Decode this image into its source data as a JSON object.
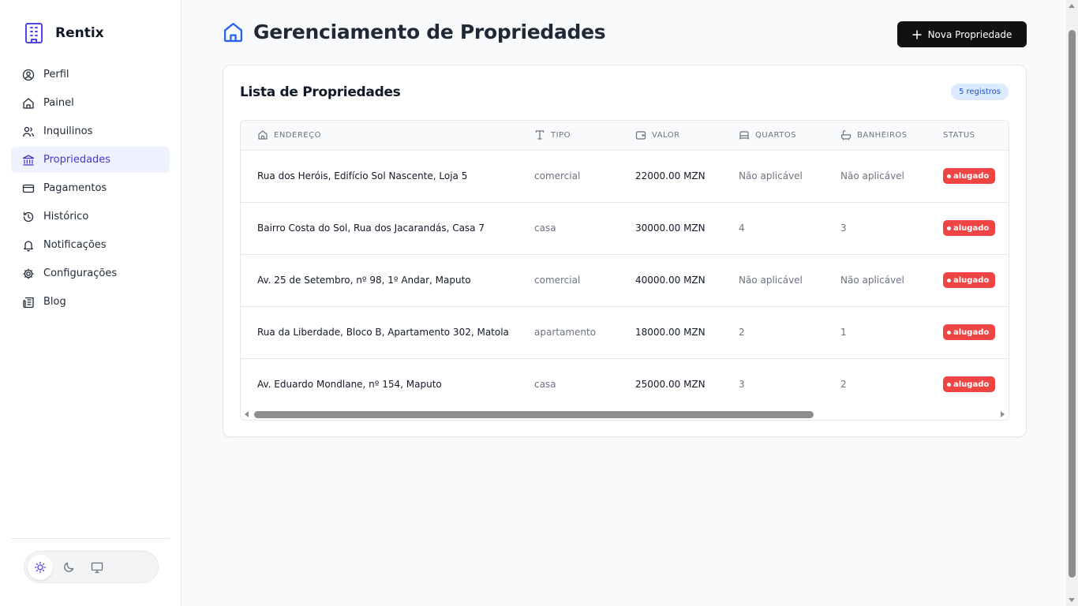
{
  "app": {
    "name": "Rentix",
    "accent": "#4f46e5"
  },
  "sidebar": {
    "items": [
      {
        "label": "Perfil",
        "icon": "user-circle-icon"
      },
      {
        "label": "Painel",
        "icon": "home-icon"
      },
      {
        "label": "Inquilinos",
        "icon": "users-icon"
      },
      {
        "label": "Propriedades",
        "icon": "bank-icon",
        "active": true
      },
      {
        "label": "Pagamentos",
        "icon": "credit-card-icon"
      },
      {
        "label": "Histórico",
        "icon": "history-icon"
      },
      {
        "label": "Notificações",
        "icon": "bell-icon"
      },
      {
        "label": "Configurações",
        "icon": "gear-icon"
      },
      {
        "label": "Blog",
        "icon": "newspaper-icon"
      }
    ],
    "theme_switcher": {
      "options": [
        "light",
        "dark",
        "system"
      ],
      "selected": "light"
    }
  },
  "header": {
    "title": "Gerenciamento de Propriedades",
    "new_button_label": "Nova Propriedade"
  },
  "card": {
    "title": "Lista de Propriedades",
    "count_badge": "5 registros"
  },
  "table": {
    "columns": [
      "ENDEREÇO",
      "TIPO",
      "VALOR",
      "QUARTOS",
      "BANHEIROS",
      "STATUS"
    ],
    "rows": [
      {
        "endereco": "Rua dos Heróis, Edifício Sol Nascente, Loja 5",
        "tipo": "comercial",
        "valor": "22000.00 MZN",
        "quartos": "Não aplicável",
        "banheiros": "Não aplicável",
        "status": "alugado"
      },
      {
        "endereco": "Bairro Costa do Sol, Rua dos Jacarandás, Casa 7",
        "tipo": "casa",
        "valor": "30000.00 MZN",
        "quartos": "4",
        "banheiros": "3",
        "status": "alugado"
      },
      {
        "endereco": "Av. 25 de Setembro, nº 98, 1º Andar, Maputo",
        "tipo": "comercial",
        "valor": "40000.00 MZN",
        "quartos": "Não aplicável",
        "banheiros": "Não aplicável",
        "status": "alugado"
      },
      {
        "endereco": "Rua da Liberdade, Bloco B, Apartamento 302, Matola",
        "tipo": "apartamento",
        "valor": "18000.00 MZN",
        "quartos": "2",
        "banheiros": "1",
        "status": "alugado"
      },
      {
        "endereco": "Av. Eduardo Mondlane, nº 154, Maputo",
        "tipo": "casa",
        "valor": "25000.00 MZN",
        "quartos": "3",
        "banheiros": "2",
        "status": "alugado"
      }
    ],
    "status_color": "#ef4444"
  }
}
